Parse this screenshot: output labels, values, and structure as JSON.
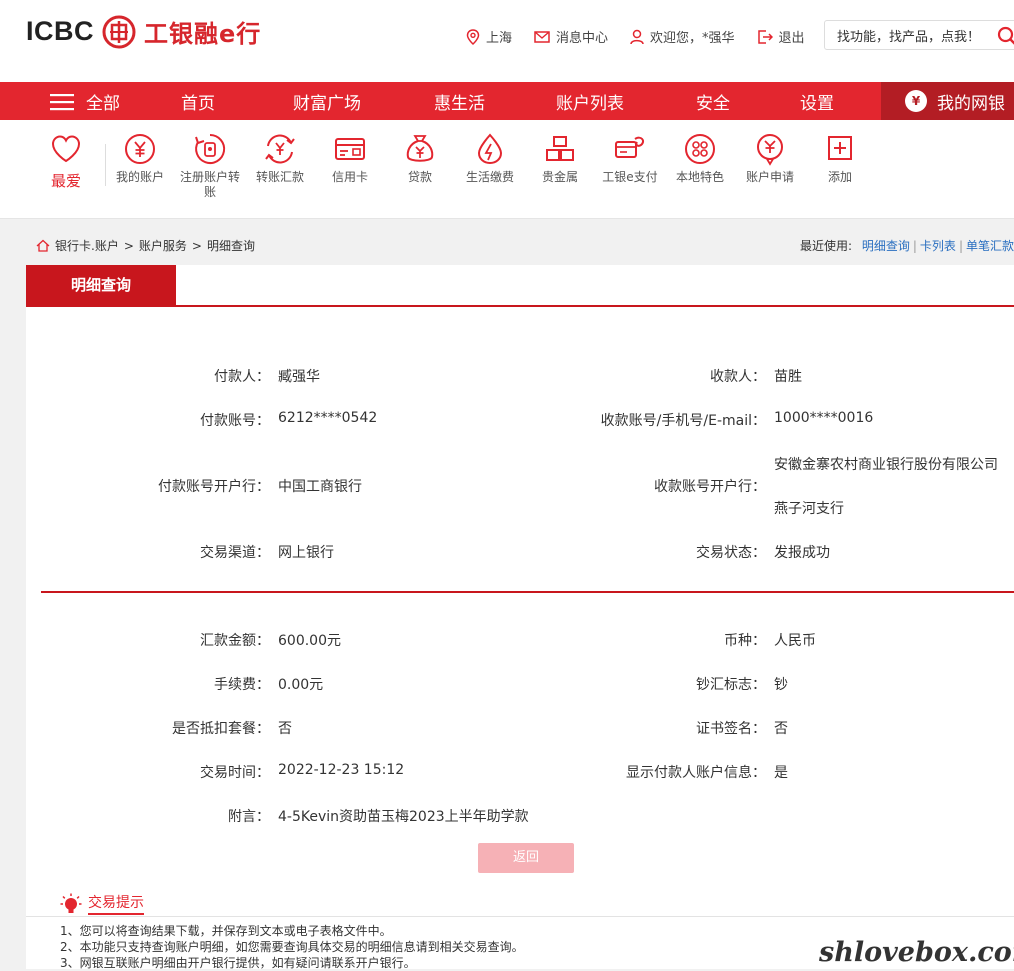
{
  "brand": {
    "logo_text": "ICBC",
    "seal_char": "工",
    "cn_name": "工银融e行"
  },
  "top_links": {
    "city": "上海",
    "messages": "消息中心",
    "welcome": "欢迎您，*强华",
    "logout": "退出"
  },
  "search": {
    "placeholder": "找功能，找产品，点我！"
  },
  "nav": {
    "all": "全部",
    "items": [
      "首页",
      "财富广场",
      "惠生活",
      "账户列表",
      "安全",
      "设置"
    ],
    "my_bank": "我的网银"
  },
  "favorites": {
    "label": "最爱"
  },
  "quick_icons": [
    {
      "label": "我的账户",
      "icon": "yen-circle-icon"
    },
    {
      "label": "注册账户转账",
      "icon": "transfer-icon"
    },
    {
      "label": "转账汇款",
      "icon": "exchange-icon"
    },
    {
      "label": "信用卡",
      "icon": "credit-card-icon"
    },
    {
      "label": "贷款",
      "icon": "money-bag-icon"
    },
    {
      "label": "生活缴费",
      "icon": "water-drop-icon"
    },
    {
      "label": "贵金属",
      "icon": "gold-bars-icon"
    },
    {
      "label": "工银e支付",
      "icon": "e-pay-icon"
    },
    {
      "label": "本地特色",
      "icon": "local-icon"
    },
    {
      "label": "账户申请",
      "icon": "apply-icon"
    },
    {
      "label": "添加",
      "icon": "plus-icon"
    }
  ],
  "breadcrumb": {
    "l1": "银行卡.账户",
    "l2": "账户服务",
    "l3": "明细查询",
    "sep": ">"
  },
  "recent": {
    "label": "最近使用:",
    "links": [
      "明细查询",
      "卡列表",
      "单笔汇款"
    ]
  },
  "tab": {
    "title": "明细查询"
  },
  "details": {
    "payer_label": "付款人：",
    "payer": "臧强华",
    "payee_label": "收款人：",
    "payee": "苗胜",
    "payer_acct_label": "付款账号：",
    "payer_acct": "6212****0542",
    "payee_acct_label": "收款账号/手机号/E-mail：",
    "payee_acct": "1000****0016",
    "payer_bank_label": "付款账号开户行：",
    "payer_bank": "中国工商银行",
    "payee_bank_label": "收款账号开户行：",
    "payee_bank_line1": "安徽金寨农村商业银行股份有限公司",
    "payee_bank_line2": "燕子河支行",
    "channel_label": "交易渠道：",
    "channel": "网上银行",
    "status_label": "交易状态：",
    "status": "发报成功",
    "amount_label": "汇款金额：",
    "amount": "600.00元",
    "currency_label": "币种：",
    "currency": "人民币",
    "fee_label": "手续费：",
    "fee": "0.00元",
    "cash_flag_label": "钞汇标志：",
    "cash_flag": "钞",
    "package_label": "是否抵扣套餐：",
    "package": "否",
    "cert_label": "证书签名：",
    "cert": "否",
    "time_label": "交易时间：",
    "time": "2022-12-23 15:12",
    "show_payer_label": "显示付款人账户信息：",
    "show_payer": "是",
    "note_label": "附言：",
    "note": "4-5Kevin资助苗玉梅2023上半年助学款"
  },
  "back_button": "返回",
  "tips": {
    "title": "交易提示",
    "items": [
      "1、您可以将查询结果下载，并保存到文本或电子表格文件中。",
      "2、本功能只支持查询账户明细，如您需要查询具体交易的明细信息请到相关交易查询。",
      "3、网银互联账户明细由开户银行提供，如有疑问请联系开户银行。"
    ]
  },
  "watermark": "shlovebox.com",
  "colors": {
    "brand_red": "#e3262f",
    "dark_red": "#c8161d",
    "link_blue": "#2a6fc0",
    "button_pink": "#f6b1b6"
  }
}
